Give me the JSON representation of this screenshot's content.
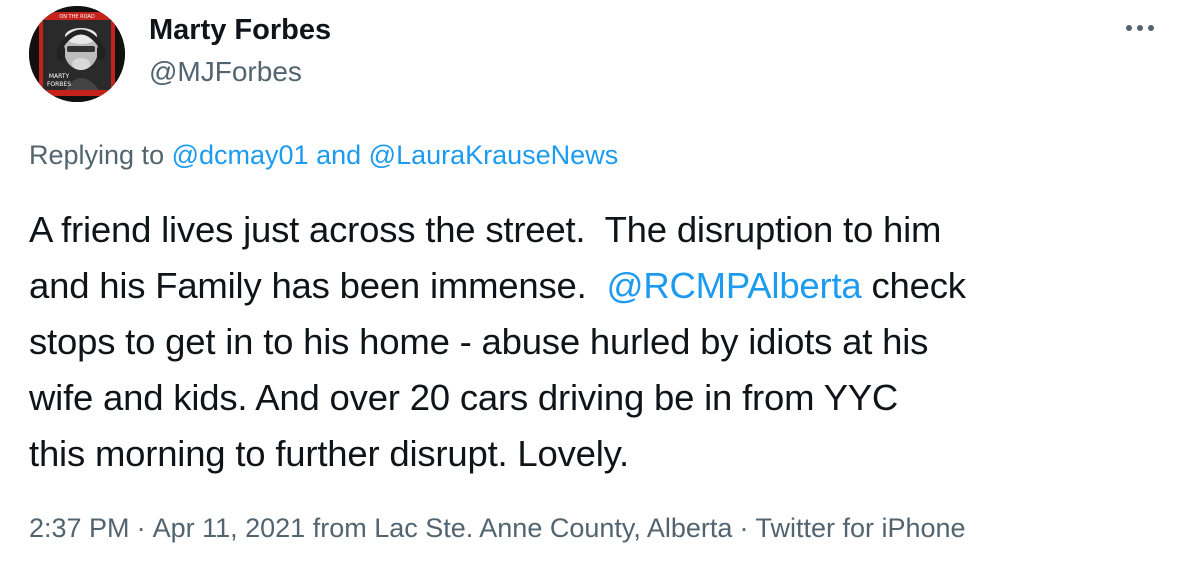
{
  "author": {
    "display_name": "Marty Forbes",
    "handle": "@MJForbes",
    "avatar_banner_text": "ON THE ROAD",
    "avatar_name_text_1": "MARTY",
    "avatar_name_text_2": "FORBES"
  },
  "more_icon": "ellipsis-icon",
  "reply": {
    "prefix": "Replying to",
    "user1": "@dcmay01",
    "conjunction": "and",
    "user2": "@LauraKrauseNews"
  },
  "body": {
    "line1": "A friend lives just across the street.  The disruption to him",
    "line2_pre": "and his Family has been immense.  ",
    "line2_mention": "@RCMPAlberta",
    "line2_post": " check",
    "line3": "stops to get in to his home - abuse hurled by idiots at his",
    "line4": "wife and kids. And over 20 cars driving be in from YYC",
    "line5": "this morning to further disrupt. Lovely."
  },
  "meta": {
    "time": "2:37 PM",
    "date": "Apr 11, 2021",
    "location": "from Lac Ste. Anne County, Alberta",
    "source": "Twitter for iPhone",
    "separator": "·"
  },
  "colors": {
    "link": "#1d9bf0",
    "secondary": "#536471",
    "text": "#0f1419",
    "avatar_accent": "#d0281f"
  }
}
